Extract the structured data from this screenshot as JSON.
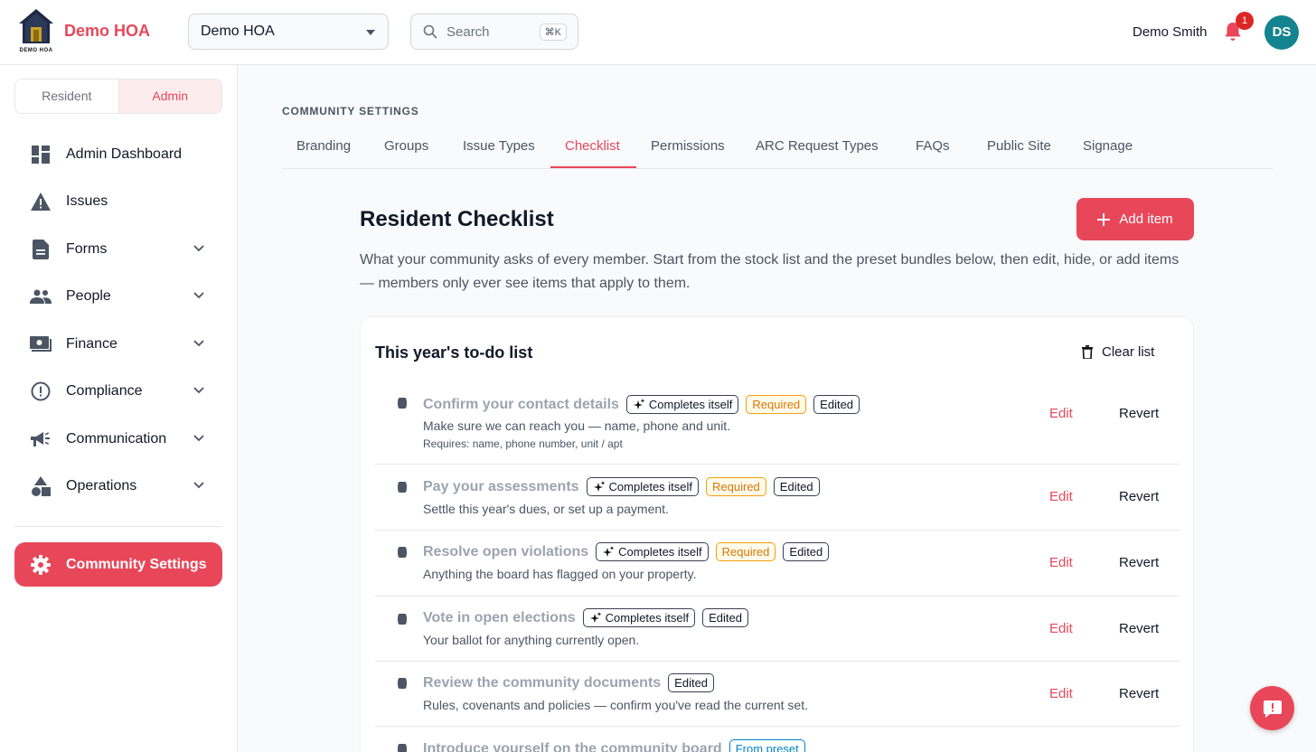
{
  "header": {
    "brand": "Demo HOA",
    "logo_caption": "DEMO HOA",
    "hoa_select_value": "Demo HOA",
    "search_placeholder": "Search",
    "search_shortcut": "⌘K",
    "user_name": "Demo Smith",
    "notification_count": "1",
    "avatar_initials": "DS"
  },
  "sidebar": {
    "roles": [
      "Resident",
      "Admin"
    ],
    "active_role": "Admin",
    "items": [
      {
        "label": "Admin Dashboard",
        "icon": "dashboard-icon",
        "expandable": false
      },
      {
        "label": "Issues",
        "icon": "warning-icon",
        "expandable": false
      },
      {
        "label": "Forms",
        "icon": "document-icon",
        "expandable": true
      },
      {
        "label": "People",
        "icon": "people-icon",
        "expandable": true
      },
      {
        "label": "Finance",
        "icon": "money-icon",
        "expandable": true
      },
      {
        "label": "Compliance",
        "icon": "alert-circle-icon",
        "expandable": true
      },
      {
        "label": "Communication",
        "icon": "megaphone-icon",
        "expandable": true
      },
      {
        "label": "Operations",
        "icon": "shapes-icon",
        "expandable": true
      }
    ],
    "settings_label": "Community Settings"
  },
  "main": {
    "section_label": "COMMUNITY SETTINGS",
    "tabs": [
      "Branding",
      "Groups",
      "Issue Types",
      "Checklist",
      "Permissions",
      "ARC Request Types",
      "FAQs",
      "Public Site",
      "Signage"
    ],
    "active_tab": "Checklist",
    "title": "Resident Checklist",
    "add_button": "Add item",
    "description": "What your community asks of every member. Start from the stock list and the preset bundles below, then edit, hide, or add items — members only ever see items that apply to them.",
    "card": {
      "title": "This year's to-do list",
      "clear_button": "Clear list",
      "rows": [
        {
          "title": "Confirm your contact details",
          "chips": [
            "Completes itself",
            "Required",
            "Edited"
          ],
          "desc": "Make sure we can reach you — name, phone and unit.",
          "requires": "Requires: name, phone number, unit / apt",
          "edit": "Edit",
          "revert": "Revert"
        },
        {
          "title": "Pay your assessments",
          "chips": [
            "Completes itself",
            "Required",
            "Edited"
          ],
          "desc": "Settle this year's dues, or set up a payment.",
          "requires": "",
          "edit": "Edit",
          "revert": "Revert"
        },
        {
          "title": "Resolve open violations",
          "chips": [
            "Completes itself",
            "Required",
            "Edited"
          ],
          "desc": "Anything the board has flagged on your property.",
          "requires": "",
          "edit": "Edit",
          "revert": "Revert"
        },
        {
          "title": "Vote in open elections",
          "chips": [
            "Completes itself",
            "Edited"
          ],
          "desc": "Your ballot for anything currently open.",
          "requires": "",
          "edit": "Edit",
          "revert": "Revert"
        },
        {
          "title": "Review the community documents",
          "chips": [
            "Edited"
          ],
          "desc": "Rules, covenants and policies — confirm you've read the current set.",
          "requires": "",
          "edit": "Edit",
          "revert": "Revert"
        },
        {
          "title": "Introduce yourself on the community board",
          "chips": [
            "From preset"
          ],
          "desc": "",
          "requires": "",
          "edit": "",
          "revert": ""
        }
      ]
    }
  },
  "colors": {
    "accent": "#e8475a",
    "avatar": "#14848f",
    "required": "#d97706",
    "preset": "#0284c7"
  }
}
